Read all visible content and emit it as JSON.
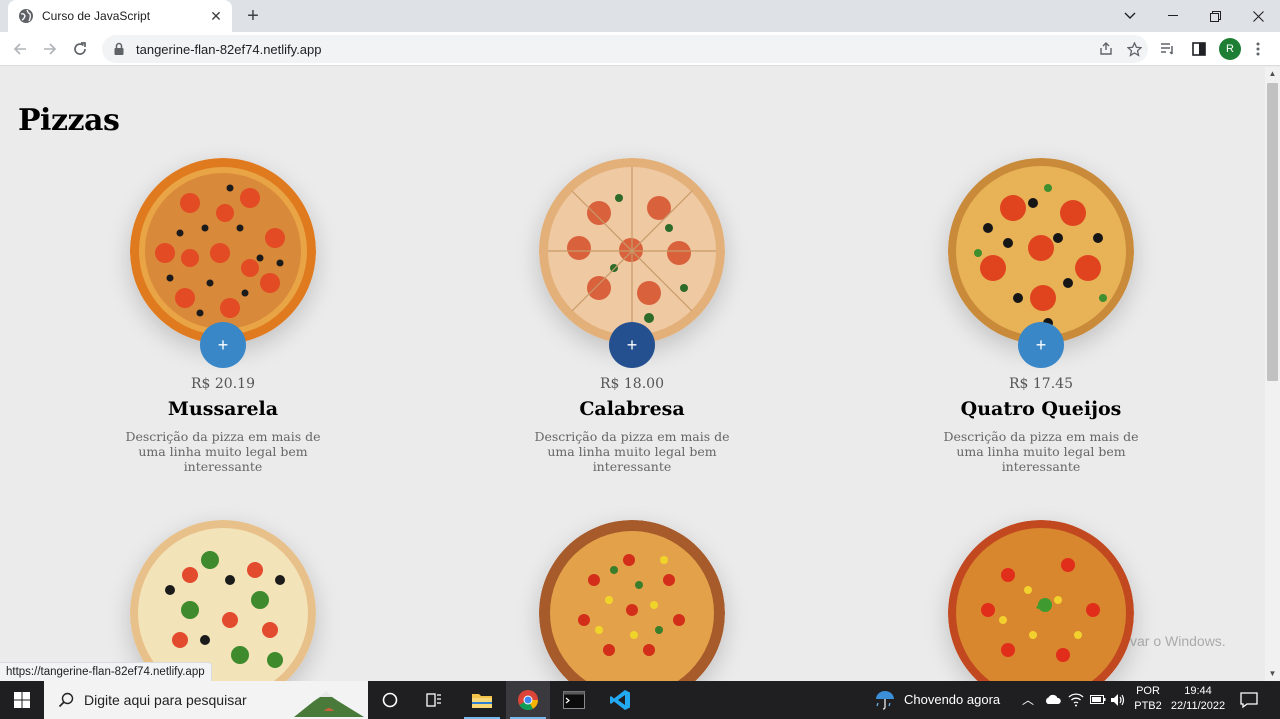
{
  "browser": {
    "tab_title": "Curso de JavaScript",
    "url": "tangerine-flan-82ef74.netlify.app",
    "profile_initial": "R",
    "status_url": "https://tangerine-flan-82ef74.netlify.app"
  },
  "page": {
    "title": "Pizzas",
    "pizzas": [
      {
        "price": "R$ 20.19",
        "name": "Mussarela",
        "description": "Descrição da pizza em mais de uma linha muito legal bem interessante",
        "button": "+"
      },
      {
        "price": "R$ 18.00",
        "name": "Calabresa",
        "description": "Descrição da pizza em mais de uma linha muito legal bem interessante",
        "button": "+"
      },
      {
        "price": "R$ 17.45",
        "name": "Quatro Queijos",
        "description": "Descrição da pizza em mais de uma linha muito legal bem interessante",
        "button": "+"
      }
    ],
    "watermark": "var o Windows."
  },
  "taskbar": {
    "search_placeholder": "Digite aqui para pesquisar",
    "weather": "Chovendo agora",
    "lang_top": "POR",
    "lang_bottom": "PTB2",
    "time": "19:44",
    "date": "22/11/2022"
  },
  "colors": {
    "add_button": "#3a87c8",
    "add_button_hover": "#24508f",
    "page_bg": "#ebebeb"
  }
}
